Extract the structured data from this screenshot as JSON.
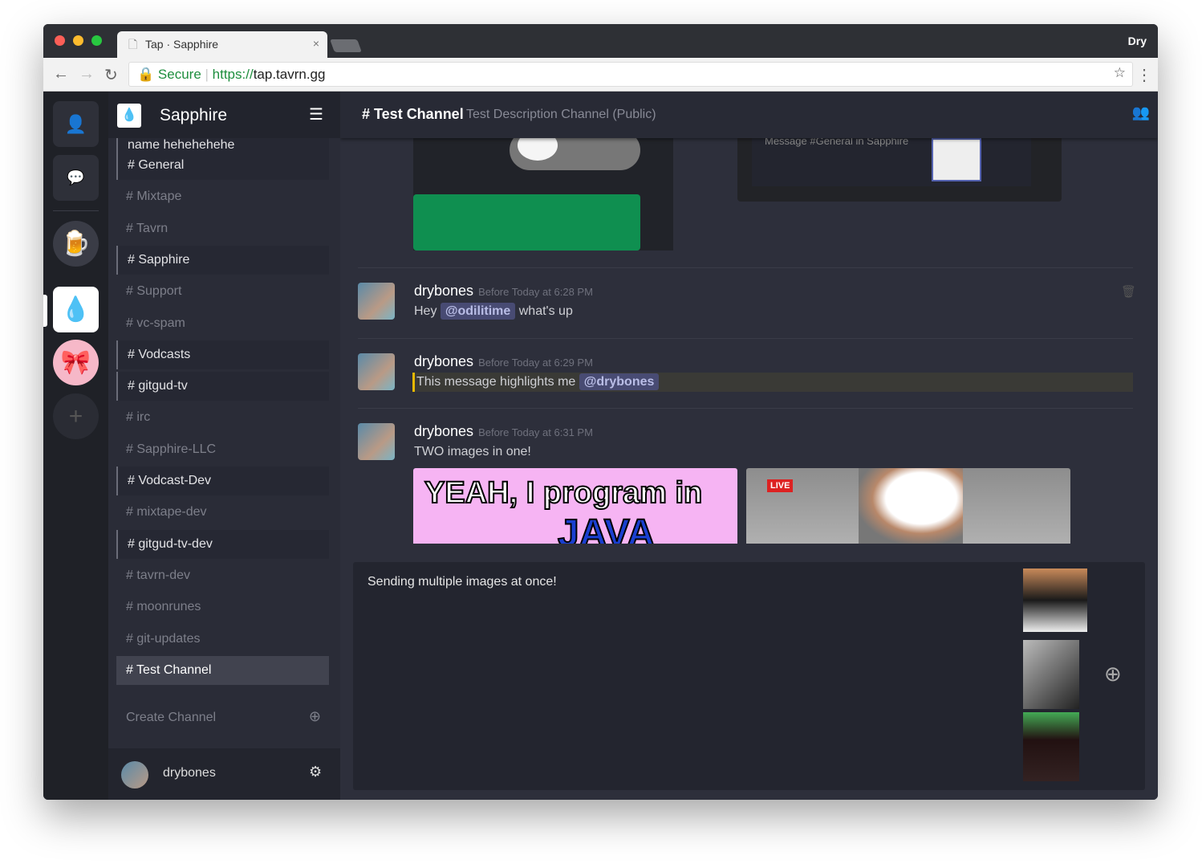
{
  "browser": {
    "tab_title": "Tap · Sapphire",
    "profile": "Dry",
    "secure_label": "Secure",
    "url_scheme": "https://",
    "url_host": "tap.tavrn.gg"
  },
  "sidebar": {
    "team_name": "Sapphire",
    "channels": [
      {
        "label": "# This is a really long channel name hehehehehe",
        "style": "bold"
      },
      {
        "label": "# General",
        "style": "bold"
      },
      {
        "label": "# Mixtape",
        "style": "muted"
      },
      {
        "label": "# Tavrn",
        "style": "muted"
      },
      {
        "label": "# Sapphire",
        "style": "bold"
      },
      {
        "label": "# Support",
        "style": "muted"
      },
      {
        "label": "# vc-spam",
        "style": "muted"
      },
      {
        "label": "# Vodcasts",
        "style": "bold"
      },
      {
        "label": "# gitgud-tv",
        "style": "bold"
      },
      {
        "label": "# irc",
        "style": "muted"
      },
      {
        "label": "# Sapphire-LLC",
        "style": "muted"
      },
      {
        "label": "# Vodcast-Dev",
        "style": "bold"
      },
      {
        "label": "# mixtape-dev",
        "style": "muted"
      },
      {
        "label": "# gitgud-tv-dev",
        "style": "bold"
      },
      {
        "label": "# tavrn-dev",
        "style": "muted"
      },
      {
        "label": "# moonrunes",
        "style": "muted"
      },
      {
        "label": "# git-updates",
        "style": "muted"
      },
      {
        "label": "# Test Channel",
        "style": "active"
      }
    ],
    "create_channel": "Create Channel",
    "username": "drybones"
  },
  "header": {
    "channel": "# Test Channel",
    "description": "Test Description Channel (Public)"
  },
  "embed": {
    "placeholder": "Message #General in Sapphire"
  },
  "messages": [
    {
      "author": "drybones",
      "time": "Before Today at 6:28 PM",
      "pre": "Hey",
      "mention": "@odilitime",
      "post": "what's up"
    },
    {
      "author": "drybones",
      "time": "Before Today at 6:29 PM",
      "pre": "This message highlights me",
      "mention": "@drybones",
      "post": ""
    },
    {
      "author": "drybones",
      "time": "Before Today at 6:31 PM",
      "pre": "TWO images in one!",
      "mention": "",
      "post": ""
    }
  ],
  "images": {
    "java_text1": "YEAH, I program in",
    "java_text2": "JAVA",
    "live_badge": "LIVE"
  },
  "composer": {
    "value": "Sending multiple images at once!"
  },
  "colors": {
    "highlight": "#3a3a36",
    "highlight_bar": "#e6b800",
    "mention_bg": "#484b73"
  }
}
